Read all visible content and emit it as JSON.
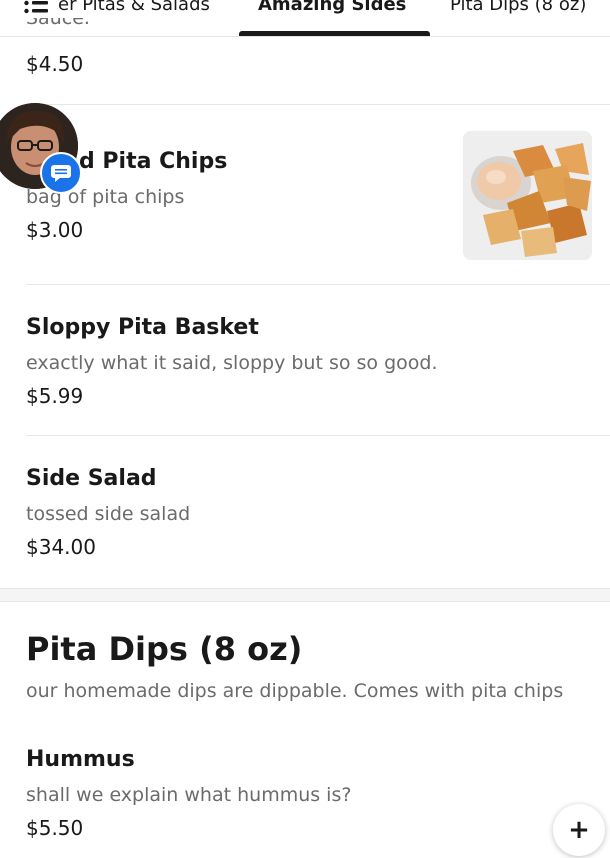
{
  "tabs": [
    {
      "label": "er Pitas & Salads"
    },
    {
      "label": "Amazing Sides"
    },
    {
      "label": "Pita Dips (8 oz)"
    }
  ],
  "prev_item": {
    "desc_fragment": "Sauce.",
    "price": "$4.50"
  },
  "items": [
    {
      "title": "d Pita Chips",
      "desc": "bag of pita chips",
      "price": "$3.00"
    },
    {
      "title": "Sloppy Pita Basket",
      "desc": "exactly what it said, sloppy but so so good.",
      "price": "$5.99"
    },
    {
      "title": "Side Salad",
      "desc": "tossed side salad",
      "price": "$34.00"
    }
  ],
  "section": {
    "title": "Pita Dips (8 oz)",
    "desc": "our homemade dips are dippable. Comes with pita chips",
    "items": [
      {
        "title": "Hummus",
        "desc": "shall we explain what hummus is?",
        "price": "$5.50"
      }
    ]
  },
  "add_button": {
    "symbol": "+"
  },
  "colors": {
    "text": "#191919",
    "muted": "#6b6b6b",
    "badge": "#1a73e8"
  }
}
